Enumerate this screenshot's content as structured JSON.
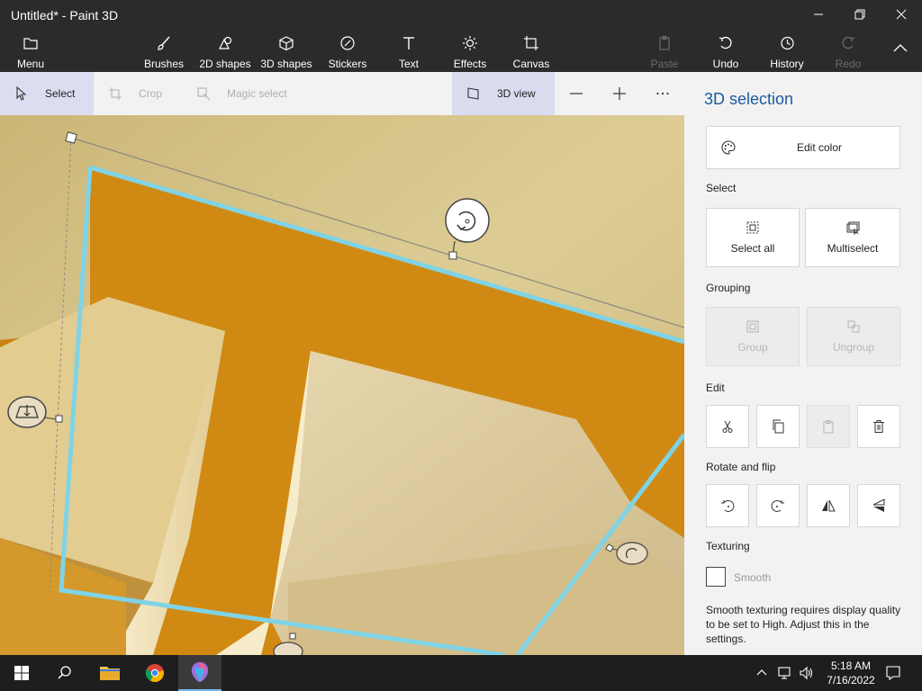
{
  "window": {
    "title": "Untitled* - Paint 3D"
  },
  "ribbon": {
    "menu": "Menu",
    "brushes": "Brushes",
    "shapes2d": "2D shapes",
    "shapes3d": "3D shapes",
    "stickers": "Stickers",
    "text": "Text",
    "effects": "Effects",
    "canvas": "Canvas",
    "paste": "Paste",
    "undo": "Undo",
    "history": "History",
    "redo": "Redo"
  },
  "toolbar": {
    "select": "Select",
    "crop": "Crop",
    "magic_select": "Magic select",
    "view3d": "3D view"
  },
  "panel": {
    "title": "3D selection",
    "edit_color": "Edit color",
    "select_heading": "Select",
    "select_all": "Select all",
    "multiselect": "Multiselect",
    "grouping_heading": "Grouping",
    "group": "Group",
    "ungroup": "Ungroup",
    "edit_heading": "Edit",
    "rotate_heading": "Rotate and flip",
    "texturing_heading": "Texturing",
    "smooth": "Smooth",
    "smooth_note": "Smooth texturing requires display quality to be set to High. Adjust this in the settings."
  },
  "taskbar": {
    "time": "5:18 AM",
    "date": "7/16/2022"
  },
  "colors": {
    "chrome": "#2b2b2b",
    "accent": "#1a5a9e",
    "selection_outline": "#7fd3e6",
    "object_orange": "#d18a12",
    "object_cream": "#e2cfa0"
  }
}
